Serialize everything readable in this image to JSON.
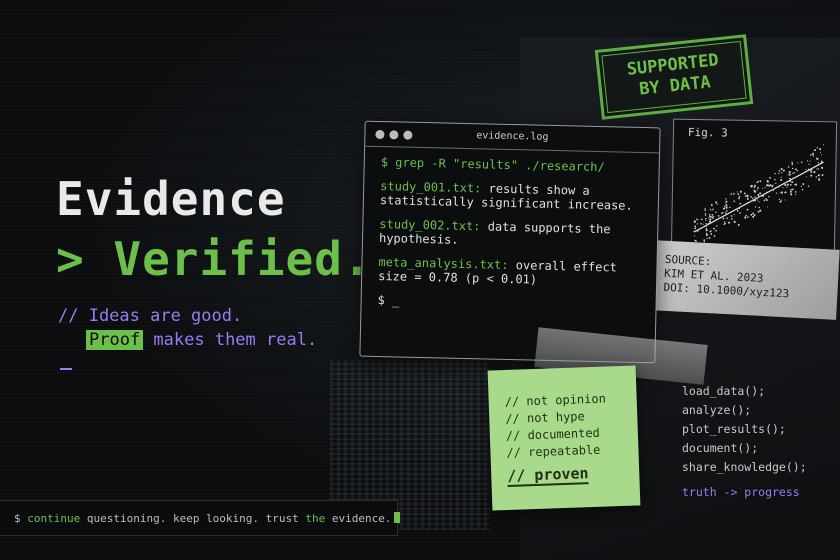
{
  "headline": {
    "line1": "Evidence",
    "line2": "> Verified."
  },
  "tagline": {
    "line1": "// Ideas are good.",
    "proof_word": "Proof",
    "line2_rest": " makes them real."
  },
  "bottom_prompt": {
    "dollar": "$",
    "continue_word": "continue",
    "middle": " questioning. keep looking. trust ",
    "the_word": "the",
    "end": " evidence."
  },
  "terminal": {
    "title": "evidence.log",
    "command": "$ grep -R \"results\" ./research/",
    "entries": [
      {
        "file": "study_001.txt:",
        "text": " results show a statistically significant increase."
      },
      {
        "file": "study_002.txt:",
        "text": " data supports the hypothesis."
      },
      {
        "file": "meta_analysis.txt:",
        "text": " overall effect size = 0.78 (p < 0.01)"
      }
    ],
    "prompt": "$ _"
  },
  "stamp": {
    "line1": "SUPPORTED",
    "line2": "BY DATA"
  },
  "figure": {
    "label": "Fig. 3"
  },
  "source": {
    "line1": "SOURCE:",
    "line2": "KIM ET AL. 2023",
    "line3": "DOI: 10.1000/xyz123"
  },
  "sticky": {
    "items": [
      "// not opinion",
      "// not hype",
      "// documented",
      "// repeatable"
    ],
    "final_prefix": "// ",
    "final_word": "proven"
  },
  "code": {
    "lines": [
      "load_data();",
      "analyze();",
      "plot_results();",
      "document();",
      "share_knowledge();"
    ],
    "truth": "truth -> progress"
  },
  "colors": {
    "accent_green": "#6cc04a",
    "accent_purple": "#9a7cf0",
    "background": "#0b0d0f"
  }
}
